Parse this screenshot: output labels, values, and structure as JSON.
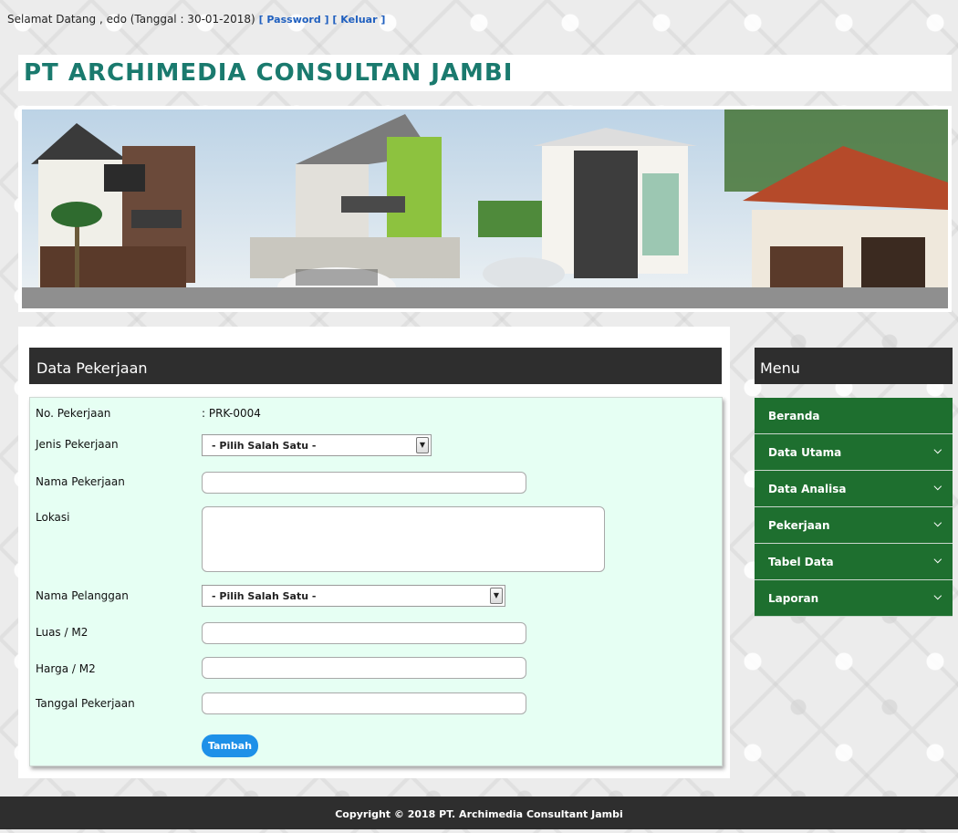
{
  "top": {
    "greeting": "Selamat Datang , edo (Tanggal : 30-01-2018)",
    "password_link": "[ Password ]",
    "logout_link": "[ Keluar ]"
  },
  "site": {
    "title": "PT ARCHIMEDIA CONSULTAN JAMBI"
  },
  "main": {
    "section_title": "Data Pekerjaan",
    "form": {
      "no_label": "No. Pekerjaan",
      "no_value": ": PRK-0004",
      "jenis_label": "Jenis Pekerjaan",
      "jenis_selected": "- Pilih Salah Satu -",
      "nama_label": "Nama Pekerjaan",
      "nama_value": "",
      "lokasi_label": "Lokasi",
      "lokasi_value": "",
      "pelanggan_label": "Nama Pelanggan",
      "pelanggan_selected": "- Pilih Salah Satu -",
      "luas_label": "Luas / M2",
      "luas_value": "",
      "harga_label": "Harga / M2",
      "harga_value": "",
      "tanggal_label": "Tanggal Pekerjaan",
      "tanggal_value": "",
      "submit_label": "Tambah"
    }
  },
  "sidebar": {
    "title": "Menu",
    "items": [
      {
        "label": "Beranda",
        "has_submenu": false
      },
      {
        "label": "Data Utama",
        "has_submenu": true
      },
      {
        "label": "Data Analisa",
        "has_submenu": true
      },
      {
        "label": "Pekerjaan",
        "has_submenu": true
      },
      {
        "label": "Tabel Data",
        "has_submenu": true
      },
      {
        "label": "Laporan",
        "has_submenu": true
      }
    ]
  },
  "footer": {
    "text": "Copyright © 2018 PT. Archimedia Consultant Jambi"
  },
  "icons": {
    "dropdown": "chevron-down-icon",
    "select_arrow": "select-arrow-icon"
  },
  "colors": {
    "title_teal": "#1a7a6e",
    "menu_green": "#1e6f2f",
    "header_dark": "#2e2e2e",
    "form_bg": "#e6fff3",
    "button_blue": "#1e90e8",
    "link_blue": "#1f5fbf"
  }
}
